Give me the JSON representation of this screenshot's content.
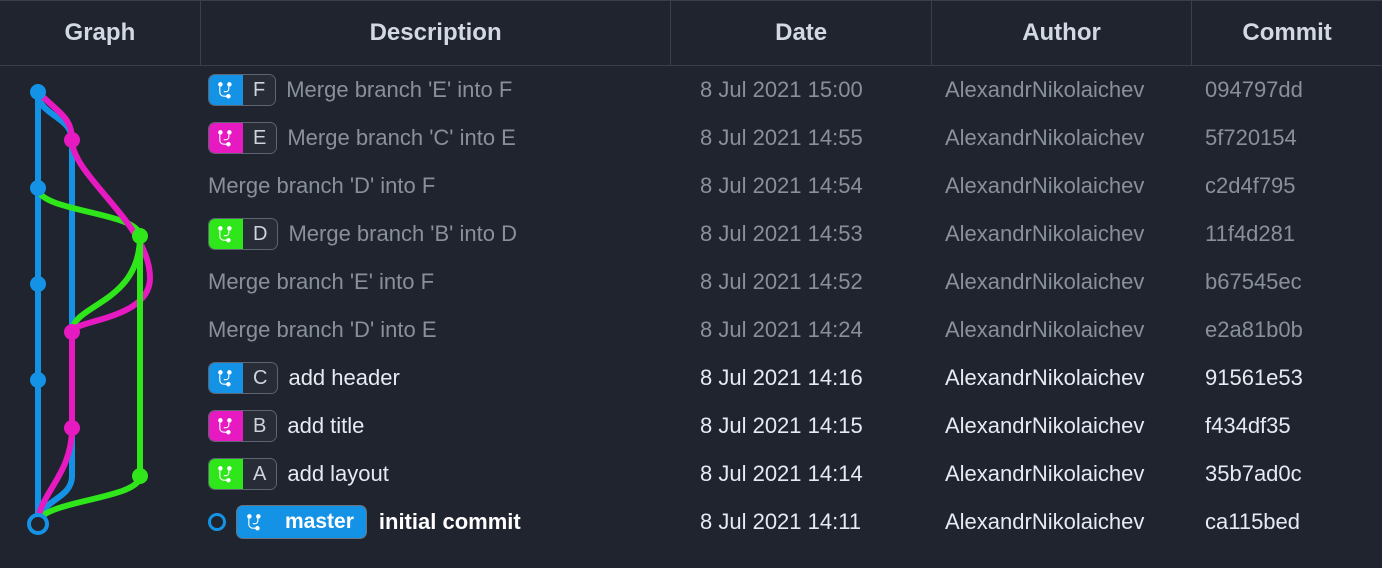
{
  "columns": {
    "graph": "Graph",
    "description": "Description",
    "date": "Date",
    "author": "Author",
    "commit": "Commit"
  },
  "colors": {
    "blue": "#1493e6",
    "pink": "#e61ac0",
    "green": "#2ee61a"
  },
  "commits": [
    {
      "branch": "F",
      "branch_color": "blue",
      "message": "Merge branch 'E' into F",
      "date": "8 Jul 2021 15:00",
      "author": "AlexandrNikolaichev",
      "hash": "094797dd",
      "dim": true,
      "head": false
    },
    {
      "branch": "E",
      "branch_color": "pink",
      "message": "Merge branch 'C' into E",
      "date": "8 Jul 2021 14:55",
      "author": "AlexandrNikolaichev",
      "hash": "5f720154",
      "dim": true,
      "head": false
    },
    {
      "branch": null,
      "message": "Merge branch 'D' into F",
      "date": "8 Jul 2021 14:54",
      "author": "AlexandrNikolaichev",
      "hash": "c2d4f795",
      "dim": true,
      "head": false
    },
    {
      "branch": "D",
      "branch_color": "green",
      "message": "Merge branch 'B' into D",
      "date": "8 Jul 2021 14:53",
      "author": "AlexandrNikolaichev",
      "hash": "11f4d281",
      "dim": true,
      "head": false
    },
    {
      "branch": null,
      "message": "Merge branch 'E' into F",
      "date": "8 Jul 2021 14:52",
      "author": "AlexandrNikolaichev",
      "hash": "b67545ec",
      "dim": true,
      "head": false
    },
    {
      "branch": null,
      "message": "Merge branch 'D' into E",
      "date": "8 Jul 2021 14:24",
      "author": "AlexandrNikolaichev",
      "hash": "e2a81b0b",
      "dim": true,
      "head": false
    },
    {
      "branch": "C",
      "branch_color": "blue",
      "message": "add header",
      "date": "8 Jul 2021 14:16",
      "author": "AlexandrNikolaichev",
      "hash": "91561e53",
      "dim": false,
      "head": false
    },
    {
      "branch": "B",
      "branch_color": "pink",
      "message": "add title",
      "date": "8 Jul 2021 14:15",
      "author": "AlexandrNikolaichev",
      "hash": "f434df35",
      "dim": false,
      "head": false
    },
    {
      "branch": "A",
      "branch_color": "green",
      "message": "add layout",
      "date": "8 Jul 2021 14:14",
      "author": "AlexandrNikolaichev",
      "hash": "35b7ad0c",
      "dim": false,
      "head": false
    },
    {
      "branch": "master",
      "branch_color": "blue",
      "message": "initial commit",
      "date": "8 Jul 2021 14:11",
      "author": "AlexandrNikolaichev",
      "hash": "ca115bed",
      "dim": false,
      "head": true
    }
  ]
}
